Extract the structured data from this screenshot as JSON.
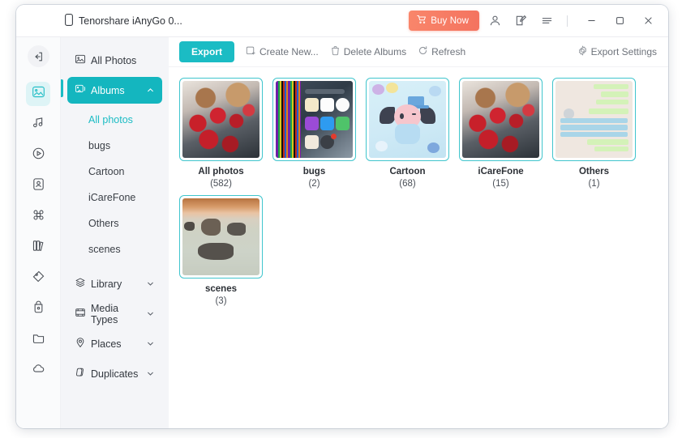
{
  "titlebar": {
    "device_name": "Tenorshare iAnyGo 0...",
    "device_icon": "phone-icon",
    "buy_now_label": "Buy Now",
    "buy_now_icon": "cart-icon",
    "account_icon": "user-icon",
    "feedback_icon": "edit-note-icon",
    "menu_icon": "hamburger-menu-icon",
    "minimize_icon": "minimize-icon",
    "maximize_icon": "maximize-icon",
    "close_icon": "close-icon",
    "buy_now_color": "#f4735f"
  },
  "rail": {
    "back_icon": "exit-arrow-icon",
    "items": [
      {
        "name": "photos",
        "icon": "photo-icon",
        "active": true
      },
      {
        "name": "music",
        "icon": "music-note-icon",
        "active": false
      },
      {
        "name": "videos",
        "icon": "play-circle-icon",
        "active": false
      },
      {
        "name": "contacts",
        "icon": "contact-card-icon",
        "active": false
      },
      {
        "name": "apps",
        "icon": "apps-grid-icon",
        "active": false
      },
      {
        "name": "books",
        "icon": "books-icon",
        "active": false
      },
      {
        "name": "bookmarks",
        "icon": "tag-icon",
        "active": false
      },
      {
        "name": "backup",
        "icon": "backup-lock-icon",
        "active": false
      },
      {
        "name": "files",
        "icon": "folder-icon",
        "active": false
      },
      {
        "name": "cloud",
        "icon": "cloud-icon",
        "active": false
      }
    ],
    "active_color": "#1bbcc4"
  },
  "sidebar": {
    "accent_color": "#14b6bf",
    "nav": [
      {
        "label": "All Photos",
        "icon": "photo-icon",
        "active": false,
        "chevron": ""
      },
      {
        "label": "Albums",
        "icon": "albums-icon",
        "active": true,
        "chevron": "up"
      }
    ],
    "albums_children": [
      {
        "label": "All photos",
        "selected": true
      },
      {
        "label": "bugs",
        "selected": false
      },
      {
        "label": "Cartoon",
        "selected": false
      },
      {
        "label": "iCareFone",
        "selected": false
      },
      {
        "label": "Others",
        "selected": false
      },
      {
        "label": "scenes",
        "selected": false
      }
    ],
    "nav_bottom": [
      {
        "label": "Library",
        "icon": "layers-icon",
        "chevron": "down"
      },
      {
        "label": "Media Types",
        "icon": "media-icon",
        "chevron": "down"
      },
      {
        "label": "Places",
        "icon": "location-pin-icon",
        "chevron": "down"
      },
      {
        "label": "Duplicates",
        "icon": "duplicates-icon",
        "chevron": "down"
      }
    ]
  },
  "toolbar": {
    "export_label": "Export",
    "export_color": "#1bbcc4",
    "create_new_label": "Create New...",
    "create_new_icon": "add-album-icon",
    "delete_albums_label": "Delete Albums",
    "delete_albums_icon": "trash-icon",
    "refresh_label": "Refresh",
    "refresh_icon": "refresh-icon",
    "export_settings_label": "Export Settings",
    "export_settings_icon": "gear-icon"
  },
  "albums": [
    {
      "name": "All photos",
      "count": "(582)",
      "art": "roses"
    },
    {
      "name": "bugs",
      "count": "(2)",
      "art": "ios"
    },
    {
      "name": "Cartoon",
      "count": "(68)",
      "art": "cartoon"
    },
    {
      "name": "iCareFone",
      "count": "(15)",
      "art": "roses"
    },
    {
      "name": "Others",
      "count": "(1)",
      "art": "chat"
    },
    {
      "name": "scenes",
      "count": "(3)",
      "art": "sea"
    }
  ]
}
